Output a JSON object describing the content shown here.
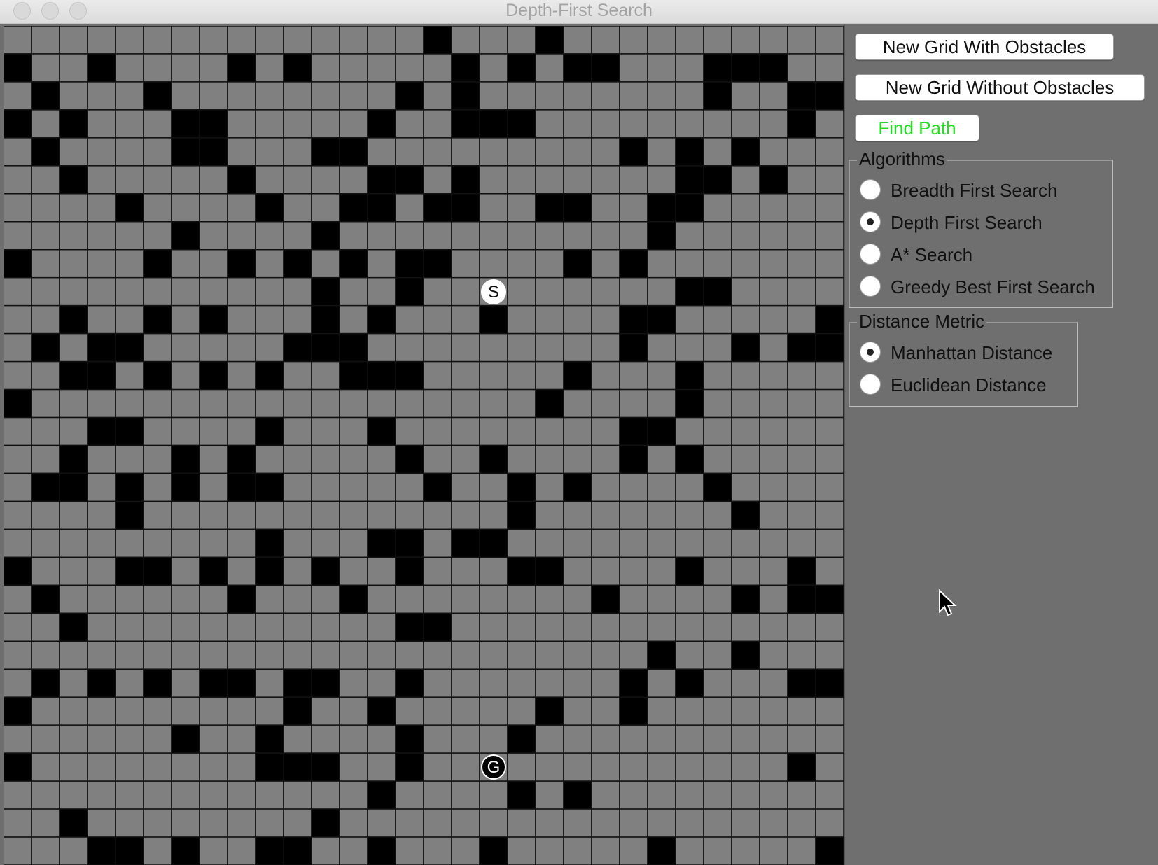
{
  "window": {
    "title": "Depth-First Search"
  },
  "grid": {
    "rows": 30,
    "cols": 30,
    "colors": {
      "free": "#808080",
      "wall": "#000000",
      "line": "#111111"
    },
    "walls": [
      [
        0,
        15
      ],
      [
        0,
        19
      ],
      [
        1,
        0
      ],
      [
        1,
        3
      ],
      [
        1,
        8
      ],
      [
        1,
        10
      ],
      [
        1,
        16
      ],
      [
        1,
        18
      ],
      [
        1,
        20
      ],
      [
        1,
        21
      ],
      [
        1,
        25
      ],
      [
        1,
        26
      ],
      [
        1,
        27
      ],
      [
        2,
        1
      ],
      [
        2,
        5
      ],
      [
        2,
        14
      ],
      [
        2,
        16
      ],
      [
        2,
        25
      ],
      [
        2,
        28
      ],
      [
        2,
        29
      ],
      [
        3,
        0
      ],
      [
        3,
        2
      ],
      [
        3,
        6
      ],
      [
        3,
        7
      ],
      [
        3,
        13
      ],
      [
        3,
        16
      ],
      [
        3,
        17
      ],
      [
        3,
        18
      ],
      [
        3,
        28
      ],
      [
        4,
        1
      ],
      [
        4,
        6
      ],
      [
        4,
        7
      ],
      [
        4,
        11
      ],
      [
        4,
        12
      ],
      [
        4,
        22
      ],
      [
        4,
        24
      ],
      [
        4,
        26
      ],
      [
        5,
        2
      ],
      [
        5,
        8
      ],
      [
        5,
        13
      ],
      [
        5,
        14
      ],
      [
        5,
        16
      ],
      [
        5,
        24
      ],
      [
        5,
        25
      ],
      [
        5,
        27
      ],
      [
        6,
        4
      ],
      [
        6,
        9
      ],
      [
        6,
        12
      ],
      [
        6,
        13
      ],
      [
        6,
        15
      ],
      [
        6,
        16
      ],
      [
        6,
        19
      ],
      [
        6,
        20
      ],
      [
        6,
        23
      ],
      [
        6,
        24
      ],
      [
        7,
        6
      ],
      [
        7,
        11
      ],
      [
        7,
        23
      ],
      [
        8,
        0
      ],
      [
        8,
        5
      ],
      [
        8,
        8
      ],
      [
        8,
        10
      ],
      [
        8,
        12
      ],
      [
        8,
        14
      ],
      [
        8,
        15
      ],
      [
        8,
        20
      ],
      [
        8,
        22
      ],
      [
        9,
        11
      ],
      [
        9,
        14
      ],
      [
        9,
        24
      ],
      [
        9,
        25
      ],
      [
        10,
        2
      ],
      [
        10,
        5
      ],
      [
        10,
        7
      ],
      [
        10,
        11
      ],
      [
        10,
        13
      ],
      [
        10,
        17
      ],
      [
        10,
        22
      ],
      [
        10,
        23
      ],
      [
        10,
        29
      ],
      [
        11,
        1
      ],
      [
        11,
        3
      ],
      [
        11,
        4
      ],
      [
        11,
        10
      ],
      [
        11,
        11
      ],
      [
        11,
        12
      ],
      [
        11,
        22
      ],
      [
        11,
        26
      ],
      [
        11,
        28
      ],
      [
        11,
        29
      ],
      [
        12,
        2
      ],
      [
        12,
        3
      ],
      [
        12,
        5
      ],
      [
        12,
        7
      ],
      [
        12,
        9
      ],
      [
        12,
        12
      ],
      [
        12,
        13
      ],
      [
        12,
        14
      ],
      [
        12,
        20
      ],
      [
        12,
        24
      ],
      [
        13,
        0
      ],
      [
        13,
        19
      ],
      [
        13,
        24
      ],
      [
        14,
        3
      ],
      [
        14,
        4
      ],
      [
        14,
        9
      ],
      [
        14,
        13
      ],
      [
        14,
        22
      ],
      [
        14,
        23
      ],
      [
        15,
        2
      ],
      [
        15,
        6
      ],
      [
        15,
        8
      ],
      [
        15,
        14
      ],
      [
        15,
        17
      ],
      [
        15,
        22
      ],
      [
        15,
        24
      ],
      [
        16,
        1
      ],
      [
        16,
        2
      ],
      [
        16,
        4
      ],
      [
        16,
        6
      ],
      [
        16,
        8
      ],
      [
        16,
        9
      ],
      [
        16,
        15
      ],
      [
        16,
        18
      ],
      [
        16,
        20
      ],
      [
        16,
        25
      ],
      [
        17,
        4
      ],
      [
        17,
        18
      ],
      [
        17,
        26
      ],
      [
        18,
        9
      ],
      [
        18,
        13
      ],
      [
        18,
        14
      ],
      [
        18,
        16
      ],
      [
        18,
        17
      ],
      [
        19,
        0
      ],
      [
        19,
        4
      ],
      [
        19,
        5
      ],
      [
        19,
        7
      ],
      [
        19,
        9
      ],
      [
        19,
        11
      ],
      [
        19,
        14
      ],
      [
        19,
        18
      ],
      [
        19,
        19
      ],
      [
        19,
        24
      ],
      [
        19,
        28
      ],
      [
        20,
        1
      ],
      [
        20,
        8
      ],
      [
        20,
        12
      ],
      [
        20,
        21
      ],
      [
        20,
        26
      ],
      [
        20,
        28
      ],
      [
        20,
        29
      ],
      [
        21,
        2
      ],
      [
        21,
        14
      ],
      [
        21,
        15
      ],
      [
        22,
        23
      ],
      [
        22,
        26
      ],
      [
        23,
        1
      ],
      [
        23,
        3
      ],
      [
        23,
        5
      ],
      [
        23,
        7
      ],
      [
        23,
        8
      ],
      [
        23,
        10
      ],
      [
        23,
        11
      ],
      [
        23,
        14
      ],
      [
        23,
        22
      ],
      [
        23,
        24
      ],
      [
        23,
        28
      ],
      [
        23,
        29
      ],
      [
        24,
        0
      ],
      [
        24,
        10
      ],
      [
        24,
        13
      ],
      [
        24,
        19
      ],
      [
        24,
        22
      ],
      [
        25,
        6
      ],
      [
        25,
        9
      ],
      [
        25,
        14
      ],
      [
        25,
        18
      ],
      [
        26,
        0
      ],
      [
        26,
        9
      ],
      [
        26,
        10
      ],
      [
        26,
        11
      ],
      [
        26,
        14
      ],
      [
        26,
        28
      ],
      [
        27,
        13
      ],
      [
        27,
        18
      ],
      [
        27,
        20
      ],
      [
        28,
        2
      ],
      [
        28,
        11
      ],
      [
        29,
        3
      ],
      [
        29,
        4
      ],
      [
        29,
        6
      ],
      [
        29,
        9
      ],
      [
        29,
        10
      ],
      [
        29,
        13
      ],
      [
        29,
        17
      ],
      [
        29,
        23
      ],
      [
        29,
        29
      ]
    ],
    "start": {
      "row": 9,
      "col": 17,
      "label": "S"
    },
    "goal": {
      "row": 26,
      "col": 17,
      "label": "G"
    }
  },
  "buttons": {
    "new_with_obstacles": "New Grid With Obstacles",
    "new_without_obstacles": "New Grid Without Obstacles",
    "find_path": "Find Path",
    "find_path_color": "#22dd22"
  },
  "algorithms": {
    "title": "Algorithms",
    "options": [
      {
        "label": "Breadth First Search",
        "selected": false
      },
      {
        "label": "Depth First Search",
        "selected": true
      },
      {
        "label": "A* Search",
        "selected": false
      },
      {
        "label": "Greedy Best First Search",
        "selected": false
      }
    ]
  },
  "distance_metric": {
    "title": "Distance Metric",
    "options": [
      {
        "label": "Manhattan Distance",
        "selected": true
      },
      {
        "label": "Euclidean Distance",
        "selected": false
      }
    ]
  }
}
